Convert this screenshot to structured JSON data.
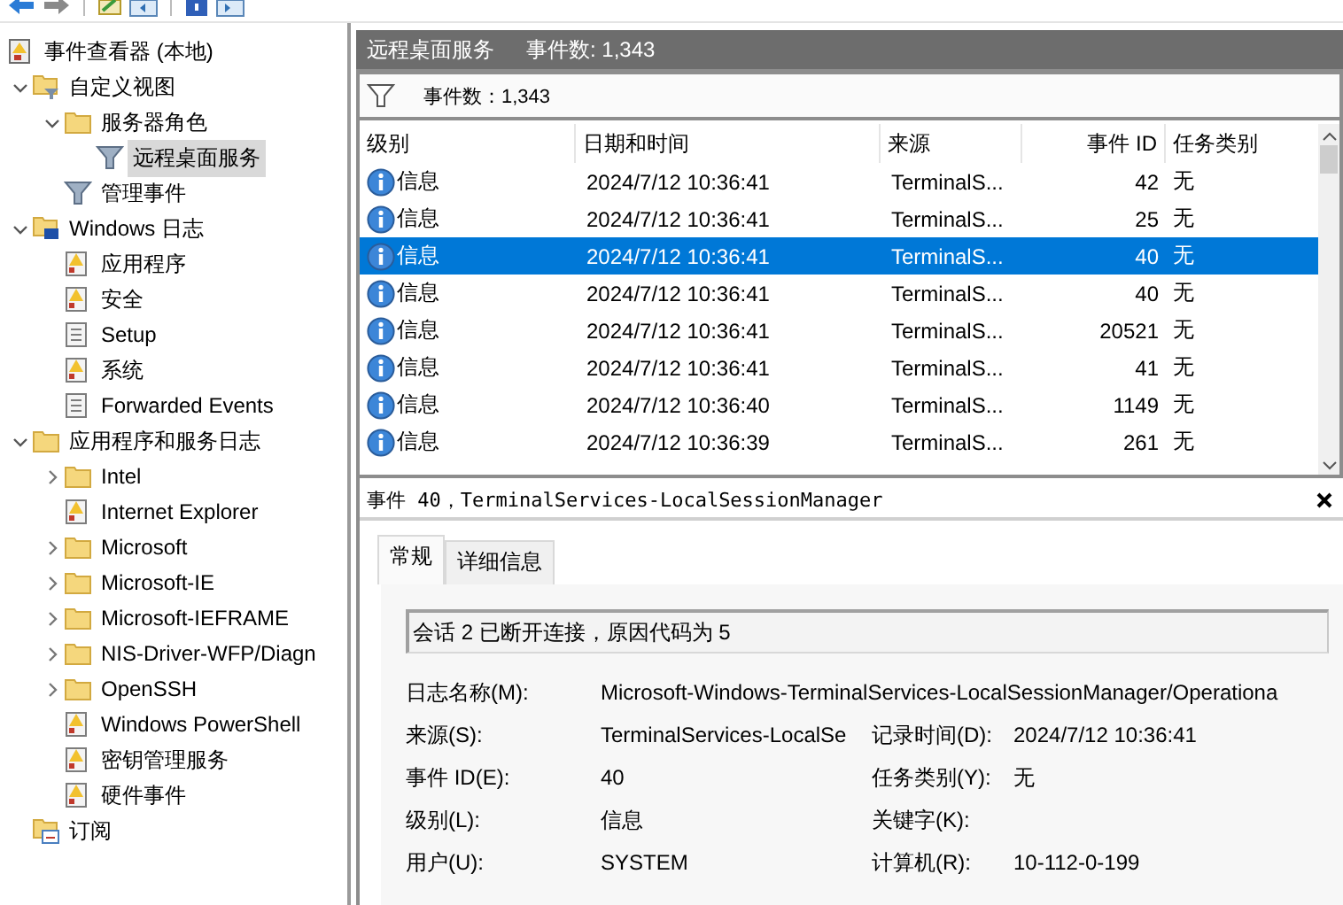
{
  "tree": [
    {
      "label": "事件查看器 (本地)",
      "kind": "viewer",
      "selected": false,
      "children": [
        {
          "label": "自定义视图",
          "kind": "filterfolder",
          "expanded": true,
          "selected": false,
          "children": [
            {
              "label": "服务器角色",
              "kind": "folder",
              "expanded": true,
              "selected": false,
              "children": [
                {
                  "label": "远程桌面服务",
                  "kind": "filter",
                  "selected": true
                }
              ]
            },
            {
              "label": "管理事件",
              "kind": "filter",
              "selected": false
            }
          ]
        },
        {
          "label": "Windows 日志",
          "kind": "winfolder",
          "expanded": true,
          "selected": false,
          "children": [
            {
              "label": "应用程序",
              "kind": "logwarn",
              "selected": false
            },
            {
              "label": "安全",
              "kind": "logwarn",
              "selected": false
            },
            {
              "label": "Setup",
              "kind": "log",
              "selected": false
            },
            {
              "label": "系统",
              "kind": "logwarn",
              "selected": false
            },
            {
              "label": "Forwarded Events",
              "kind": "log",
              "selected": false
            }
          ]
        },
        {
          "label": "应用程序和服务日志",
          "kind": "folder",
          "expanded": true,
          "selected": false,
          "children": [
            {
              "label": "Intel",
              "kind": "folder",
              "expanded": false,
              "selected": false
            },
            {
              "label": "Internet Explorer",
              "kind": "logwarn",
              "selected": false
            },
            {
              "label": "Microsoft",
              "kind": "folder",
              "expanded": false,
              "selected": false
            },
            {
              "label": "Microsoft-IE",
              "kind": "folder",
              "expanded": false,
              "selected": false
            },
            {
              "label": "Microsoft-IEFRAME",
              "kind": "folder",
              "expanded": false,
              "selected": false
            },
            {
              "label": "NIS-Driver-WFP/Diagn",
              "kind": "folder",
              "expanded": false,
              "selected": false
            },
            {
              "label": "OpenSSH",
              "kind": "folder",
              "expanded": false,
              "selected": false
            },
            {
              "label": "Windows PowerShell",
              "kind": "logwarn",
              "selected": false
            },
            {
              "label": "密钥管理服务",
              "kind": "logwarn",
              "selected": false
            },
            {
              "label": "硬件事件",
              "kind": "logwarn",
              "selected": false
            }
          ]
        },
        {
          "label": "订阅",
          "kind": "subscription",
          "selected": false
        }
      ]
    }
  ],
  "header": {
    "title": "远程桌面服务",
    "count": "事件数: 1,343"
  },
  "filter_bar": {
    "count": "事件数：1,343"
  },
  "table": {
    "columns": [
      "级别",
      "日期和时间",
      "来源",
      "事件 ID",
      "任务类别"
    ],
    "rows": [
      {
        "level": "信息",
        "date": "2024/7/12 10:36:41",
        "source": "TerminalS...",
        "event_id": "42",
        "task": "无",
        "selected": false
      },
      {
        "level": "信息",
        "date": "2024/7/12 10:36:41",
        "source": "TerminalS...",
        "event_id": "25",
        "task": "无",
        "selected": false
      },
      {
        "level": "信息",
        "date": "2024/7/12 10:36:41",
        "source": "TerminalS...",
        "event_id": "40",
        "task": "无",
        "selected": true
      },
      {
        "level": "信息",
        "date": "2024/7/12 10:36:41",
        "source": "TerminalS...",
        "event_id": "40",
        "task": "无",
        "selected": false
      },
      {
        "level": "信息",
        "date": "2024/7/12 10:36:41",
        "source": "TerminalS...",
        "event_id": "20521",
        "task": "无",
        "selected": false
      },
      {
        "level": "信息",
        "date": "2024/7/12 10:36:41",
        "source": "TerminalS...",
        "event_id": "41",
        "task": "无",
        "selected": false
      },
      {
        "level": "信息",
        "date": "2024/7/12 10:36:40",
        "source": "TerminalS...",
        "event_id": "1149",
        "task": "无",
        "selected": false
      },
      {
        "level": "信息",
        "date": "2024/7/12 10:36:39",
        "source": "TerminalS...",
        "event_id": "261",
        "task": "无",
        "selected": false
      }
    ]
  },
  "detail": {
    "title": "事件 40，TerminalServices-LocalSessionManager",
    "tabs": [
      {
        "label": "常规",
        "selected": true
      },
      {
        "label": "详细信息",
        "selected": false
      }
    ],
    "description": "会话 2 已断开连接，原因代码为 5",
    "fields": [
      {
        "label": "日志名称(M):",
        "value": "Microsoft-Windows-TerminalServices-LocalSessionManager/Operationa"
      },
      {
        "label": "来源(S):",
        "value": "TerminalServices-LocalSe",
        "label2": "记录时间(D):",
        "value2": "2024/7/12 10:36:41"
      },
      {
        "label": "事件 ID(E):",
        "value": "40",
        "label2": "任务类别(Y):",
        "value2": "无"
      },
      {
        "label": "级别(L):",
        "value": "信息",
        "label2": "关键字(K):"
      },
      {
        "label": "用户(U):",
        "value": "SYSTEM",
        "label2": "计算机(R):",
        "value2": "10-112-0-199"
      }
    ]
  }
}
